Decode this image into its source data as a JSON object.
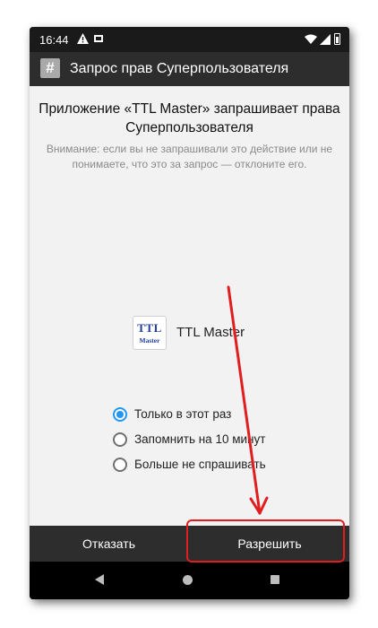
{
  "status_bar": {
    "time": "16:44",
    "icons": [
      "warning-icon",
      "screen-icon",
      "wifi-icon",
      "signal-icon",
      "battery-icon"
    ]
  },
  "title_bar": {
    "icon": "superuser-hash-icon",
    "icon_glyph": "#",
    "title": "Запрос прав Суперпользователя"
  },
  "request": {
    "heading": "Приложение «TTL Master» запрашивает права Суперпользователя",
    "warning": "Внимание: если вы не запрашивали это действие или не понимаете, что это за запрос — отклоните его."
  },
  "app": {
    "icon_text_top": "TTL",
    "icon_text_bottom": "Master",
    "name": "TTL Master"
  },
  "options": [
    {
      "label": "Только в этот раз",
      "selected": true
    },
    {
      "label": "Запомнить на 10 минут",
      "selected": false
    },
    {
      "label": "Больше не спрашивать",
      "selected": false
    }
  ],
  "buttons": {
    "deny": "Отказать",
    "allow": "Разрешить"
  },
  "nav": [
    "back-icon",
    "home-icon",
    "recents-icon"
  ],
  "colors": {
    "accent": "#2196f3",
    "annotation": "#e11d1d",
    "bar": "#2d2d2d",
    "content_bg": "#f2f2f2"
  }
}
